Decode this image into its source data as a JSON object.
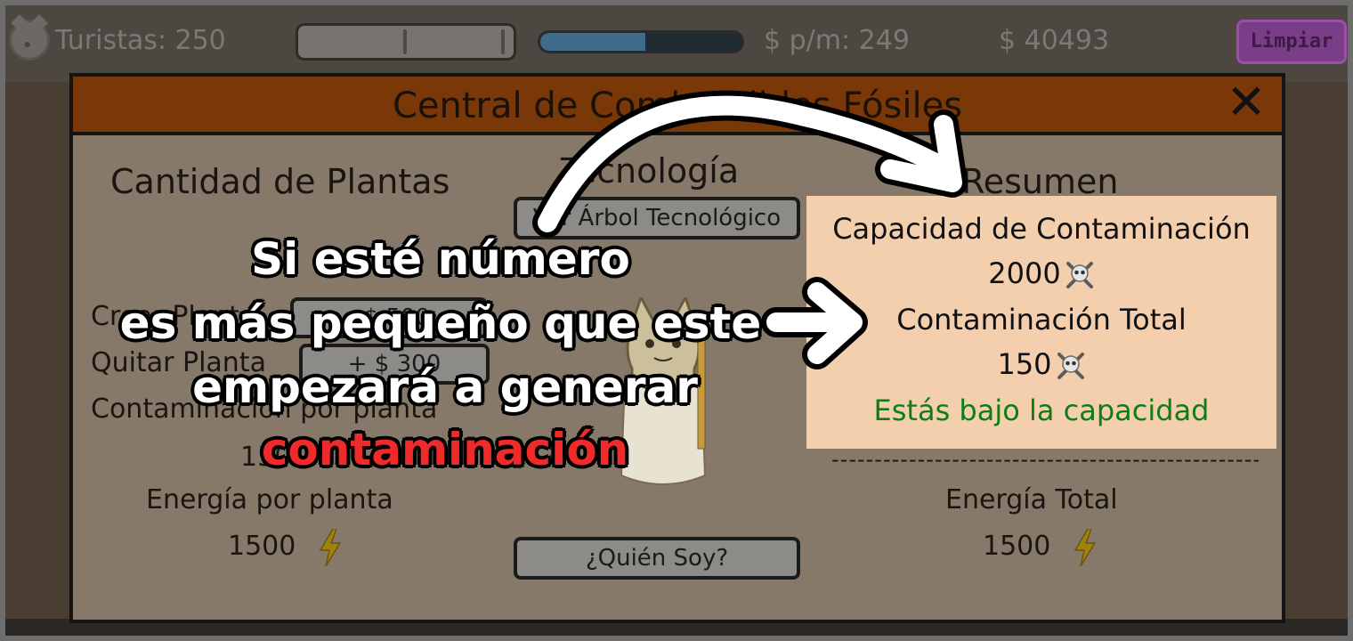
{
  "hud": {
    "tourists": "Turistas: 250",
    "progress_fraction": 0.52,
    "per_minute": "$ p/m: 249",
    "money": "$ 40493",
    "clean_button": "Limpiar"
  },
  "modal": {
    "title": "Central de Combustibles Fósiles",
    "close": "✕",
    "plants": {
      "title": "Cantidad de Plantas",
      "buy_label": "Crear Planta",
      "buy_button": "- $ 500",
      "sell_label": "Quitar Planta",
      "sell_button": "+ $ 300",
      "contamination_label": "Contaminación por planta",
      "contamination_value": "150",
      "energy_label": "Energía por planta",
      "energy_value": "1500"
    },
    "technology": {
      "title": "Tecnología",
      "tree_button": "Ver Árbol Tecnológico",
      "who_button": "¿Quién Soy?"
    },
    "summary": {
      "title": "Resumen",
      "capacity_label": "Capacidad de Contaminación",
      "capacity_value": "2000",
      "total_label": "Contaminación Total",
      "total_value": "150",
      "status": "Estás bajo la capacidad",
      "separator": "----------------------------------------------------------",
      "energy_total_label": "Energía Total",
      "energy_total_value": "1500"
    }
  },
  "overlay": {
    "line1": "Si esté número",
    "line2": "es más pequeño que este",
    "line3": "empezará a generar",
    "line4": "contaminación"
  },
  "colors": {
    "header": "#7a3707",
    "summary_bg": "#f4cfae",
    "status_green": "#0f7d14",
    "highlight_red": "#ee2a2a",
    "limpiar_purple": "#7a3d87"
  },
  "icons": {
    "tourist": "pig-face-icon",
    "energy": "lightning-bolt-icon",
    "pollution": "skull-crossbones-icon",
    "close": "close-icon"
  }
}
